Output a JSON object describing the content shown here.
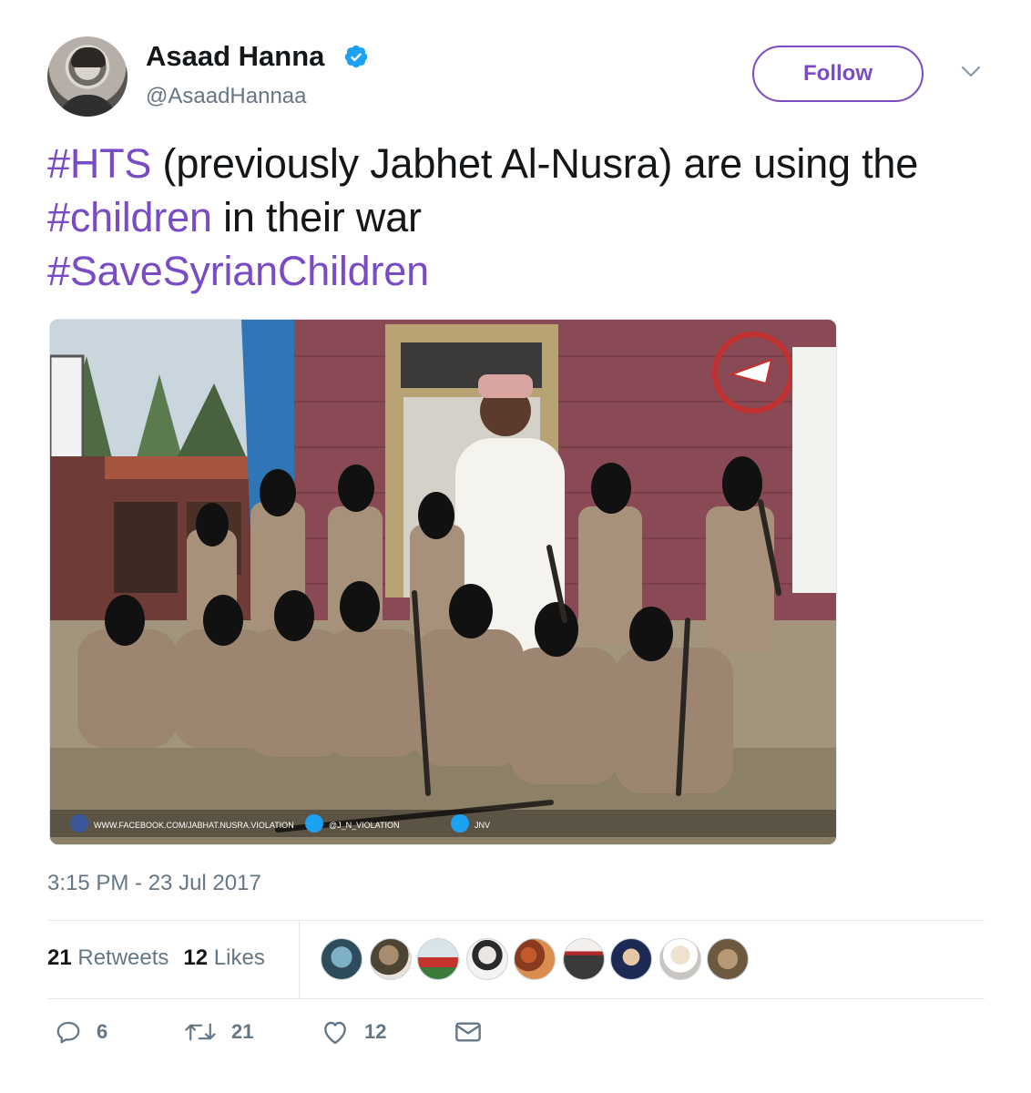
{
  "header": {
    "name": "Asaad Hanna",
    "handle": "@AsaadHannaa",
    "follow_label": "Follow",
    "verified_icon": "verified-badge-icon",
    "menu_icon": "chevron-down-icon"
  },
  "tweet": {
    "parts": [
      {
        "text": "#HTS",
        "hashtag": true
      },
      {
        "text": " (previously Jabhet Al-Nusra) are using the ",
        "hashtag": false
      },
      {
        "text": "#children",
        "hashtag": true
      },
      {
        "text": " in their war ",
        "hashtag": false
      },
      {
        "text": "#SaveSyrianChildren",
        "hashtag": true
      }
    ],
    "timestamp": "3:15 PM - 23 Jul 2017"
  },
  "photo": {
    "watermark_facebook": "WWW.FACEBOOK.COM/JABHAT.NUSRA.VIOLATION",
    "watermark_twitter": "@J_N_VIOLATION",
    "watermark_other": "JNV"
  },
  "stats": {
    "retweets_count": "21",
    "retweets_label": "Retweets",
    "likes_count": "12",
    "likes_label": "Likes"
  },
  "actions": {
    "reply_count": "6",
    "retweet_count": "21",
    "like_count": "12"
  },
  "colors": {
    "accent": "#794bc4",
    "text": "#14171a",
    "secondary": "#657786",
    "divider": "#e1e8ed"
  }
}
